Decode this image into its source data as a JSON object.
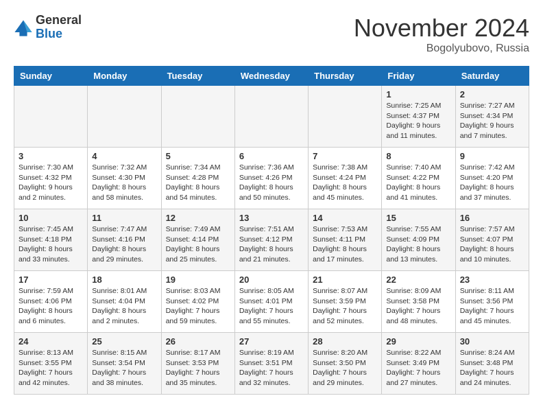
{
  "header": {
    "logo_general": "General",
    "logo_blue": "Blue",
    "month_title": "November 2024",
    "location": "Bogolyubovo, Russia"
  },
  "columns": [
    "Sunday",
    "Monday",
    "Tuesday",
    "Wednesday",
    "Thursday",
    "Friday",
    "Saturday"
  ],
  "weeks": [
    [
      {
        "day": "",
        "info": ""
      },
      {
        "day": "",
        "info": ""
      },
      {
        "day": "",
        "info": ""
      },
      {
        "day": "",
        "info": ""
      },
      {
        "day": "",
        "info": ""
      },
      {
        "day": "1",
        "info": "Sunrise: 7:25 AM\nSunset: 4:37 PM\nDaylight: 9 hours\nand 11 minutes."
      },
      {
        "day": "2",
        "info": "Sunrise: 7:27 AM\nSunset: 4:34 PM\nDaylight: 9 hours\nand 7 minutes."
      }
    ],
    [
      {
        "day": "3",
        "info": "Sunrise: 7:30 AM\nSunset: 4:32 PM\nDaylight: 9 hours\nand 2 minutes."
      },
      {
        "day": "4",
        "info": "Sunrise: 7:32 AM\nSunset: 4:30 PM\nDaylight: 8 hours\nand 58 minutes."
      },
      {
        "day": "5",
        "info": "Sunrise: 7:34 AM\nSunset: 4:28 PM\nDaylight: 8 hours\nand 54 minutes."
      },
      {
        "day": "6",
        "info": "Sunrise: 7:36 AM\nSunset: 4:26 PM\nDaylight: 8 hours\nand 50 minutes."
      },
      {
        "day": "7",
        "info": "Sunrise: 7:38 AM\nSunset: 4:24 PM\nDaylight: 8 hours\nand 45 minutes."
      },
      {
        "day": "8",
        "info": "Sunrise: 7:40 AM\nSunset: 4:22 PM\nDaylight: 8 hours\nand 41 minutes."
      },
      {
        "day": "9",
        "info": "Sunrise: 7:42 AM\nSunset: 4:20 PM\nDaylight: 8 hours\nand 37 minutes."
      }
    ],
    [
      {
        "day": "10",
        "info": "Sunrise: 7:45 AM\nSunset: 4:18 PM\nDaylight: 8 hours\nand 33 minutes."
      },
      {
        "day": "11",
        "info": "Sunrise: 7:47 AM\nSunset: 4:16 PM\nDaylight: 8 hours\nand 29 minutes."
      },
      {
        "day": "12",
        "info": "Sunrise: 7:49 AM\nSunset: 4:14 PM\nDaylight: 8 hours\nand 25 minutes."
      },
      {
        "day": "13",
        "info": "Sunrise: 7:51 AM\nSunset: 4:12 PM\nDaylight: 8 hours\nand 21 minutes."
      },
      {
        "day": "14",
        "info": "Sunrise: 7:53 AM\nSunset: 4:11 PM\nDaylight: 8 hours\nand 17 minutes."
      },
      {
        "day": "15",
        "info": "Sunrise: 7:55 AM\nSunset: 4:09 PM\nDaylight: 8 hours\nand 13 minutes."
      },
      {
        "day": "16",
        "info": "Sunrise: 7:57 AM\nSunset: 4:07 PM\nDaylight: 8 hours\nand 10 minutes."
      }
    ],
    [
      {
        "day": "17",
        "info": "Sunrise: 7:59 AM\nSunset: 4:06 PM\nDaylight: 8 hours\nand 6 minutes."
      },
      {
        "day": "18",
        "info": "Sunrise: 8:01 AM\nSunset: 4:04 PM\nDaylight: 8 hours\nand 2 minutes."
      },
      {
        "day": "19",
        "info": "Sunrise: 8:03 AM\nSunset: 4:02 PM\nDaylight: 7 hours\nand 59 minutes."
      },
      {
        "day": "20",
        "info": "Sunrise: 8:05 AM\nSunset: 4:01 PM\nDaylight: 7 hours\nand 55 minutes."
      },
      {
        "day": "21",
        "info": "Sunrise: 8:07 AM\nSunset: 3:59 PM\nDaylight: 7 hours\nand 52 minutes."
      },
      {
        "day": "22",
        "info": "Sunrise: 8:09 AM\nSunset: 3:58 PM\nDaylight: 7 hours\nand 48 minutes."
      },
      {
        "day": "23",
        "info": "Sunrise: 8:11 AM\nSunset: 3:56 PM\nDaylight: 7 hours\nand 45 minutes."
      }
    ],
    [
      {
        "day": "24",
        "info": "Sunrise: 8:13 AM\nSunset: 3:55 PM\nDaylight: 7 hours\nand 42 minutes."
      },
      {
        "day": "25",
        "info": "Sunrise: 8:15 AM\nSunset: 3:54 PM\nDaylight: 7 hours\nand 38 minutes."
      },
      {
        "day": "26",
        "info": "Sunrise: 8:17 AM\nSunset: 3:53 PM\nDaylight: 7 hours\nand 35 minutes."
      },
      {
        "day": "27",
        "info": "Sunrise: 8:19 AM\nSunset: 3:51 PM\nDaylight: 7 hours\nand 32 minutes."
      },
      {
        "day": "28",
        "info": "Sunrise: 8:20 AM\nSunset: 3:50 PM\nDaylight: 7 hours\nand 29 minutes."
      },
      {
        "day": "29",
        "info": "Sunrise: 8:22 AM\nSunset: 3:49 PM\nDaylight: 7 hours\nand 27 minutes."
      },
      {
        "day": "30",
        "info": "Sunrise: 8:24 AM\nSunset: 3:48 PM\nDaylight: 7 hours\nand 24 minutes."
      }
    ]
  ]
}
